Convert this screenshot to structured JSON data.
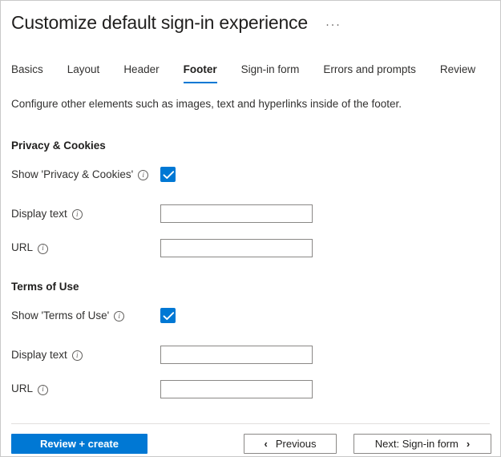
{
  "header": {
    "title": "Customize default sign-in experience",
    "more_icon": "···",
    "more_icon_name": "ellipsis-icon"
  },
  "tabs": [
    {
      "label": "Basics",
      "active": false
    },
    {
      "label": "Layout",
      "active": false
    },
    {
      "label": "Header",
      "active": false
    },
    {
      "label": "Footer",
      "active": true
    },
    {
      "label": "Sign-in form",
      "active": false
    },
    {
      "label": "Errors and prompts",
      "active": false
    },
    {
      "label": "Review",
      "active": false
    }
  ],
  "description": "Configure other elements such as images, text and hyperlinks inside of the footer.",
  "sections": [
    {
      "title": "Privacy & Cookies",
      "toggle": {
        "label": "Show 'Privacy & Cookies'",
        "info": "i",
        "checked": true
      },
      "display_text": {
        "label": "Display text",
        "info": "i",
        "value": "",
        "placeholder": ""
      },
      "url": {
        "label": "URL",
        "info": "i",
        "value": "",
        "placeholder": ""
      }
    },
    {
      "title": "Terms of Use",
      "toggle": {
        "label": "Show 'Terms of Use'",
        "info": "i",
        "checked": true
      },
      "display_text": {
        "label": "Display text",
        "info": "i",
        "value": "",
        "placeholder": ""
      },
      "url": {
        "label": "URL",
        "info": "i",
        "value": "",
        "placeholder": ""
      }
    }
  ],
  "footer": {
    "review_create_label": "Review + create",
    "previous_label": "Previous",
    "previous_chevron": "‹",
    "next_label": "Next: Sign-in form",
    "next_chevron": "›"
  },
  "colors": {
    "accent": "#0078d4",
    "text": "#323130",
    "border": "#8a8886",
    "divider": "#e1dfdd"
  }
}
